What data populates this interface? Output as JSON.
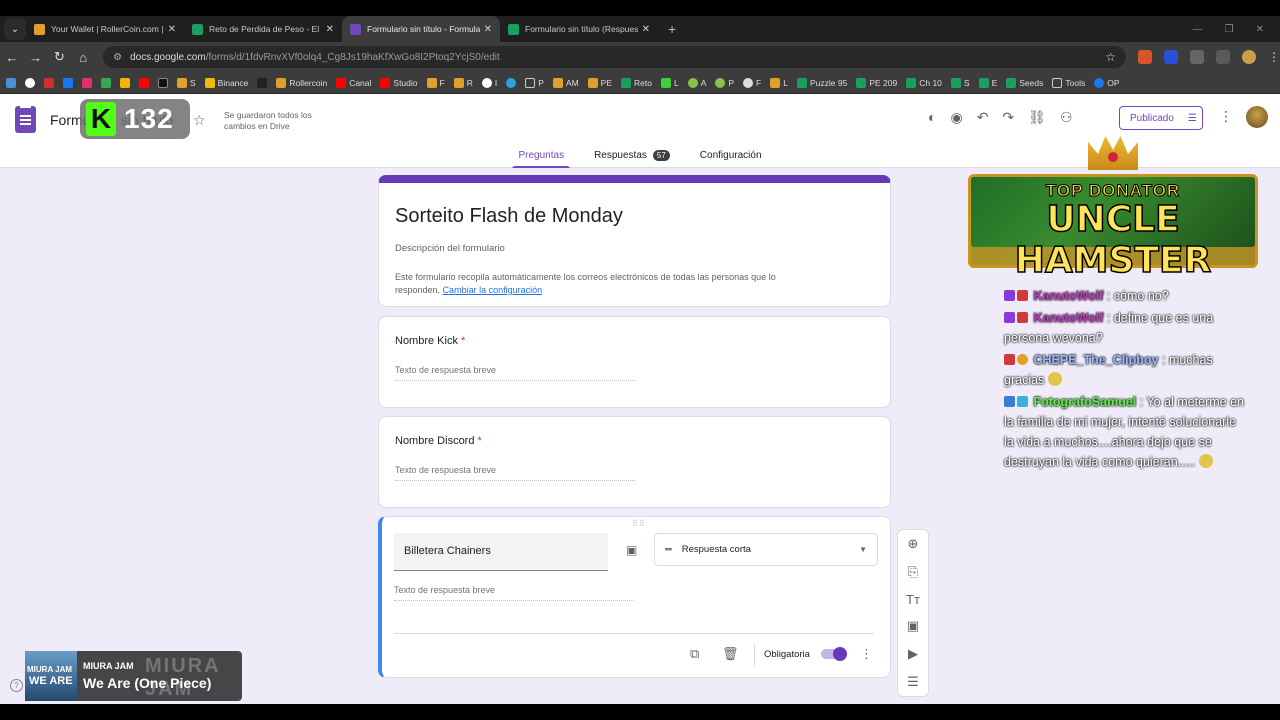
{
  "browser": {
    "tabs": [
      {
        "title": "Your Wallet | RollerCoin.com | T",
        "color": "#e0a12a",
        "active": false
      },
      {
        "title": "Reto de Perdida de Peso - El M",
        "color": "#18a05e",
        "active": false
      },
      {
        "title": "Formulario sin título - Formula",
        "color": "#7248b9",
        "active": true
      },
      {
        "title": "Formulario sin título (Respuesta",
        "color": "#18a05e",
        "active": false
      }
    ],
    "url_host": "docs.google.com",
    "url_path": "/forms/d/1fdvRnvXVf0olq4_Cg8Js19haKfXwGo8I2Ptoq2YcjS0/edit",
    "bookmarks": [
      "S",
      "Binance",
      "Rollercoin",
      "Canal",
      "Studio",
      "F",
      "R",
      "I",
      "P",
      "AM",
      "PE",
      "Reto",
      "L",
      "A",
      "P",
      "F",
      "L",
      "Puzzle 95",
      "PE 209",
      "Ch 10",
      "S",
      "E",
      "Seeds",
      "Tools",
      "OP"
    ]
  },
  "forms": {
    "doc_title": "Formulario sin título",
    "saved_status": "Se guardaron todos los cambios en Drive",
    "publish_label": "Publicado",
    "tabs": {
      "questions": "Preguntas",
      "responses": "Respuestas",
      "responses_count": "57",
      "settings": "Configuración"
    },
    "form_title": "Sorteito Flash de Monday",
    "form_description": "Descripción del formulario",
    "email_note": "Este formulario recopila automáticamente los correos electrónicos de todas las personas que lo responden.",
    "change_settings_link": "Cambiar la configuración",
    "questions": [
      {
        "label": "Nombre Kick",
        "placeholder": "Texto de respuesta breve",
        "required_mark": "*"
      },
      {
        "label": "Nombre Discord",
        "placeholder": "Texto de respuesta breve",
        "required_mark": "*"
      }
    ],
    "active_question": {
      "label": "Billetera Chainers",
      "type": "Respuesta corta",
      "placeholder": "Texto de respuesta breve",
      "required_label": "Obligatoria"
    }
  },
  "overlay": {
    "kick_count": "132",
    "donator_top": "TOP DONATOR",
    "donator_name": "UNCLE HAMSTER",
    "chat": [
      {
        "user": "KanutoWolf",
        "color": "purple",
        "text": ": cómo no?"
      },
      {
        "user": "KanutoWolf",
        "color": "purple",
        "text": ": define que es una persona wevona?"
      },
      {
        "user": "CHEPE_The_Clipboy",
        "color": "blue",
        "text": ": muchas gracias"
      },
      {
        "user": "FotografoSamuel",
        "color": "green",
        "text": ": Yo al meterme en la familia de mi mujer, intenté solucionarle la vida a muchos....ahora dejo que se destruyan la vida como quieran....."
      }
    ],
    "music": {
      "artist": "MIURA JAM",
      "track": "We Are (One Piece)",
      "art_top": "MIURA JAM",
      "art_bottom": "WE ARE",
      "bg_text": "MIURA JAM"
    }
  }
}
